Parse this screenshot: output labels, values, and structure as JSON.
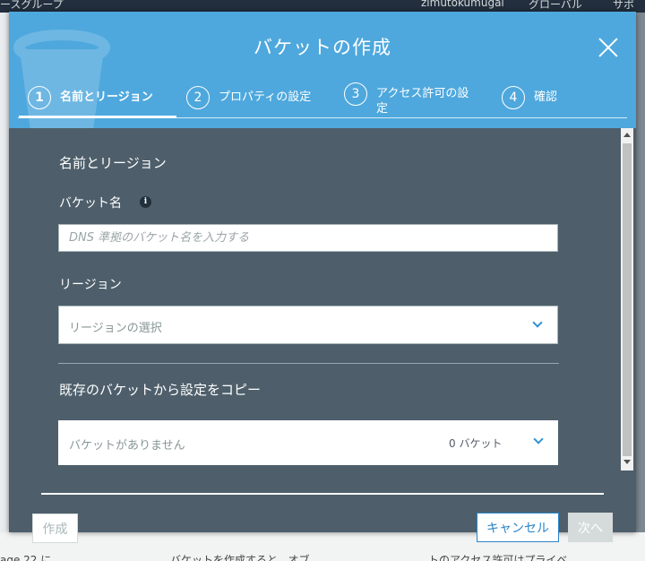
{
  "background": {
    "topbar_left": "ースグループ",
    "user": "zimutokumugai",
    "region_menu": "グローバル",
    "support": "サポ",
    "bottom_left": "age 22 に",
    "bottom_mid": "バケットを作成すると、オブ",
    "bottom_right": "トのアクセス許可はプライベ"
  },
  "modal": {
    "title": "バケットの作成",
    "steps": [
      {
        "num": "1",
        "label": "名前とリージョン",
        "active": true
      },
      {
        "num": "2",
        "label": "プロパティの設定",
        "active": false
      },
      {
        "num": "3",
        "label_line1": "アクセス許可の設",
        "label_line2": "定",
        "active": false
      },
      {
        "num": "4",
        "label": "確認",
        "active": false
      }
    ],
    "section_title": "名前とリージョン",
    "bucket_name_label": "バケット名",
    "bucket_name_info": "i",
    "bucket_name_placeholder": "DNS 準拠のバケット名を入力する",
    "region_label": "リージョン",
    "region_select_value": "リージョンの選択",
    "copy_section_title": "既存のバケットから設定をコピー",
    "copy_select_value": "バケットがありません",
    "copy_bucket_count": "0 バケット",
    "buttons": {
      "create": "作成",
      "cancel": "キャンセル",
      "next": "次へ"
    }
  },
  "colors": {
    "header_blue": "#4ea8dd",
    "body_slate": "#4e5f6b",
    "link_blue": "#2a85c8"
  }
}
